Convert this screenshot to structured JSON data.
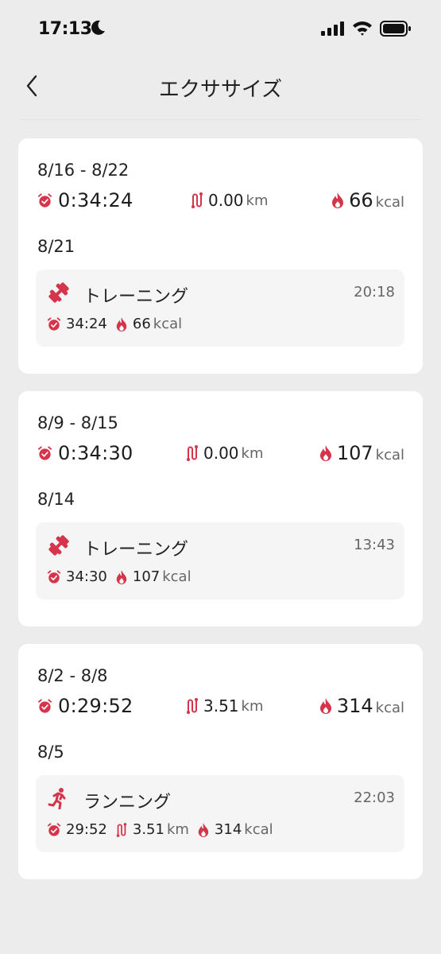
{
  "status_bar": {
    "time": "17:13"
  },
  "header": {
    "title": "エクササイズ"
  },
  "colors": {
    "accent": "#d6344a",
    "background": "#ececec",
    "card": "#ffffff",
    "item": "#f5f5f5"
  },
  "weeks": [
    {
      "range": "8/16 - 8/22",
      "duration": "0:34:24",
      "distance": "0.00",
      "distance_unit": "km",
      "calories": "66",
      "calories_unit": "kcal",
      "day": "8/21",
      "activity": {
        "icon": "dumbbell-icon",
        "name": "トレーニング",
        "time": "20:18",
        "duration": "34:24",
        "calories": "66",
        "calories_unit": "kcal"
      }
    },
    {
      "range": "8/9 - 8/15",
      "duration": "0:34:30",
      "distance": "0.00",
      "distance_unit": "km",
      "calories": "107",
      "calories_unit": "kcal",
      "day": "8/14",
      "activity": {
        "icon": "dumbbell-icon",
        "name": "トレーニング",
        "time": "13:43",
        "duration": "34:30",
        "calories": "107",
        "calories_unit": "kcal"
      }
    },
    {
      "range": "8/2 - 8/8",
      "duration": "0:29:52",
      "distance": "3.51",
      "distance_unit": "km",
      "calories": "314",
      "calories_unit": "kcal",
      "day": "8/5",
      "activity": {
        "icon": "running-icon",
        "name": "ランニング",
        "time": "22:03",
        "duration": "29:52",
        "distance": "3.51",
        "distance_unit": "km",
        "calories": "314",
        "calories_unit": "kcal"
      }
    }
  ]
}
